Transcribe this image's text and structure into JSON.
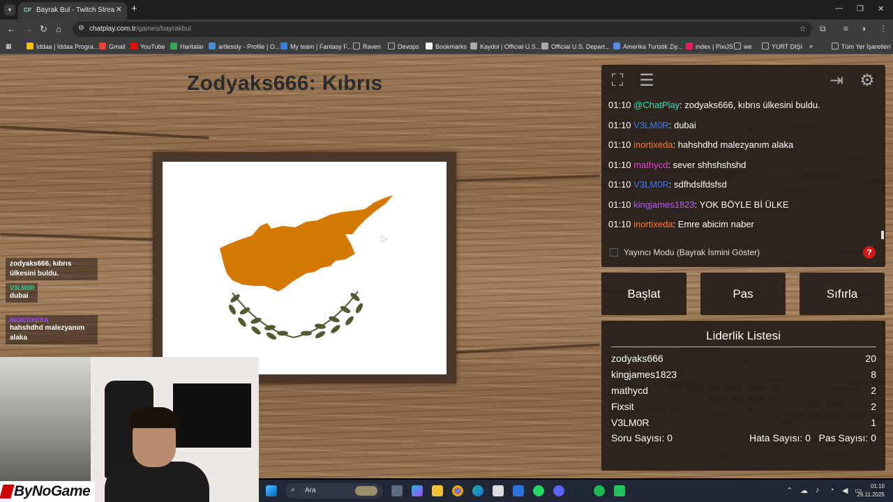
{
  "browser": {
    "tab_title": "Bayrak Bul - Twitch Stream Game",
    "tab_favicon": "CP",
    "url_host": "chatplay.com.tr",
    "url_path": "/games/bayrakbul",
    "bookmarks": [
      {
        "label": "İddaa | İddaa Progra...",
        "icon": "iddaa-icon",
        "color": "#f2c200"
      },
      {
        "label": "Gmail",
        "icon": "gmail-icon",
        "color": "#ea4335"
      },
      {
        "label": "YouTube",
        "icon": "youtube-icon",
        "color": "#ff0000"
      },
      {
        "label": "Haritalar",
        "icon": "maps-icon",
        "color": "#34a853"
      },
      {
        "label": "artlessly - Profile | O...",
        "icon": "osu-icon",
        "color": "#4a90d9"
      },
      {
        "label": "My team | Fantasy F...",
        "icon": "fantasy-icon",
        "color": "#3b7ddd"
      },
      {
        "label": "Raven",
        "icon": "folder-icon",
        "color": "#bbbbbb"
      },
      {
        "label": "Devops",
        "icon": "folder-icon",
        "color": "#bbbbbb"
      },
      {
        "label": "Bookmarks",
        "icon": "github-icon",
        "color": "#ffffff"
      },
      {
        "label": "Kaydol | Official U.S...",
        "icon": "link-icon",
        "color": "#aaaaaa"
      },
      {
        "label": "Official U.S. Depart...",
        "icon": "link-icon",
        "color": "#aaaaaa"
      },
      {
        "label": "Amerika Turistik Ziy...",
        "icon": "e-icon",
        "color": "#5a8de8"
      },
      {
        "label": "index | PixiJS",
        "icon": "pixi-icon",
        "color": "#e91e63"
      },
      {
        "label": "we",
        "icon": "folder-icon",
        "color": "#bbbbbb"
      },
      {
        "label": "YURT DIŞI",
        "icon": "folder-icon",
        "color": "#bbbbbb"
      }
    ],
    "bookmarks_more": "»",
    "all_bookmarks": "Tüm Yer İşaretleri"
  },
  "game": {
    "title": "Zodyaks666: Kıbrıs"
  },
  "overlay_chat": [
    {
      "user": "",
      "text": "zodyaks666, kıbrıs ülkesini buldu.",
      "color": "#ffffff"
    },
    {
      "user": "V3LM0R",
      "text": "dubai",
      "color": "#2bd48f"
    },
    {
      "user": "INORTIXEDA",
      "text": "hahshdhd malezyanım alaka",
      "color": "#9a4dff"
    }
  ],
  "chat": {
    "messages": [
      {
        "time": "01:10",
        "user": "@ChatPlay",
        "color": "#2ee6c0",
        "text": ": zodyaks666, kıbrıs ülkesini buldu."
      },
      {
        "time": "01:10",
        "user": "V3LM0R",
        "color": "#3a7bff",
        "text": ": dubai"
      },
      {
        "time": "01:10",
        "user": "inortixeda",
        "color": "#ff7b2e",
        "text": ": hahshdhd malezyanım alaka"
      },
      {
        "time": "01:10",
        "user": "mathycd",
        "color": "#e23de2",
        "text": ": sever shhshshshd"
      },
      {
        "time": "01:10",
        "user": "V3LM0R",
        "color": "#3a7bff",
        "text": ": sdfhdslfdsfsd"
      },
      {
        "time": "01:10",
        "user": "kingjames1823",
        "color": "#b55cff",
        "text": ": YOK BÖYLE Bİ ÜLKE"
      },
      {
        "time": "01:10",
        "user": "inortixeda",
        "color": "#ff7b2e",
        "text": ": Emre abicim naber"
      }
    ],
    "streamer_mode_label": "Yayıncı Modu (Bayrak İsmini Göster)",
    "help": "?"
  },
  "buttons": {
    "start": "Başlat",
    "pass": "Pas",
    "reset": "Sıfırla"
  },
  "leaderboard": {
    "title": "Liderlik Listesi",
    "rows": [
      {
        "name": "zodyaks666",
        "score": "20"
      },
      {
        "name": "kingjames1823",
        "score": "8"
      },
      {
        "name": "mathycd",
        "score": "2"
      },
      {
        "name": "Fixsit",
        "score": "2"
      },
      {
        "name": "V3LM0R",
        "score": "1"
      }
    ],
    "question_count": "Soru Sayısı: 0",
    "error_count": "Hata Sayısı: 0",
    "pass_count": "Pas Sayısı: 0"
  },
  "stream": {
    "logo_text": "ByNoGame"
  },
  "taskbar": {
    "search_placeholder": "Ara",
    "time": "01:10",
    "date": "26.11.2025"
  },
  "colors": {
    "flag_island": "#d57800",
    "flag_olive": "#4e5b31",
    "accent_red": "#d01818"
  }
}
